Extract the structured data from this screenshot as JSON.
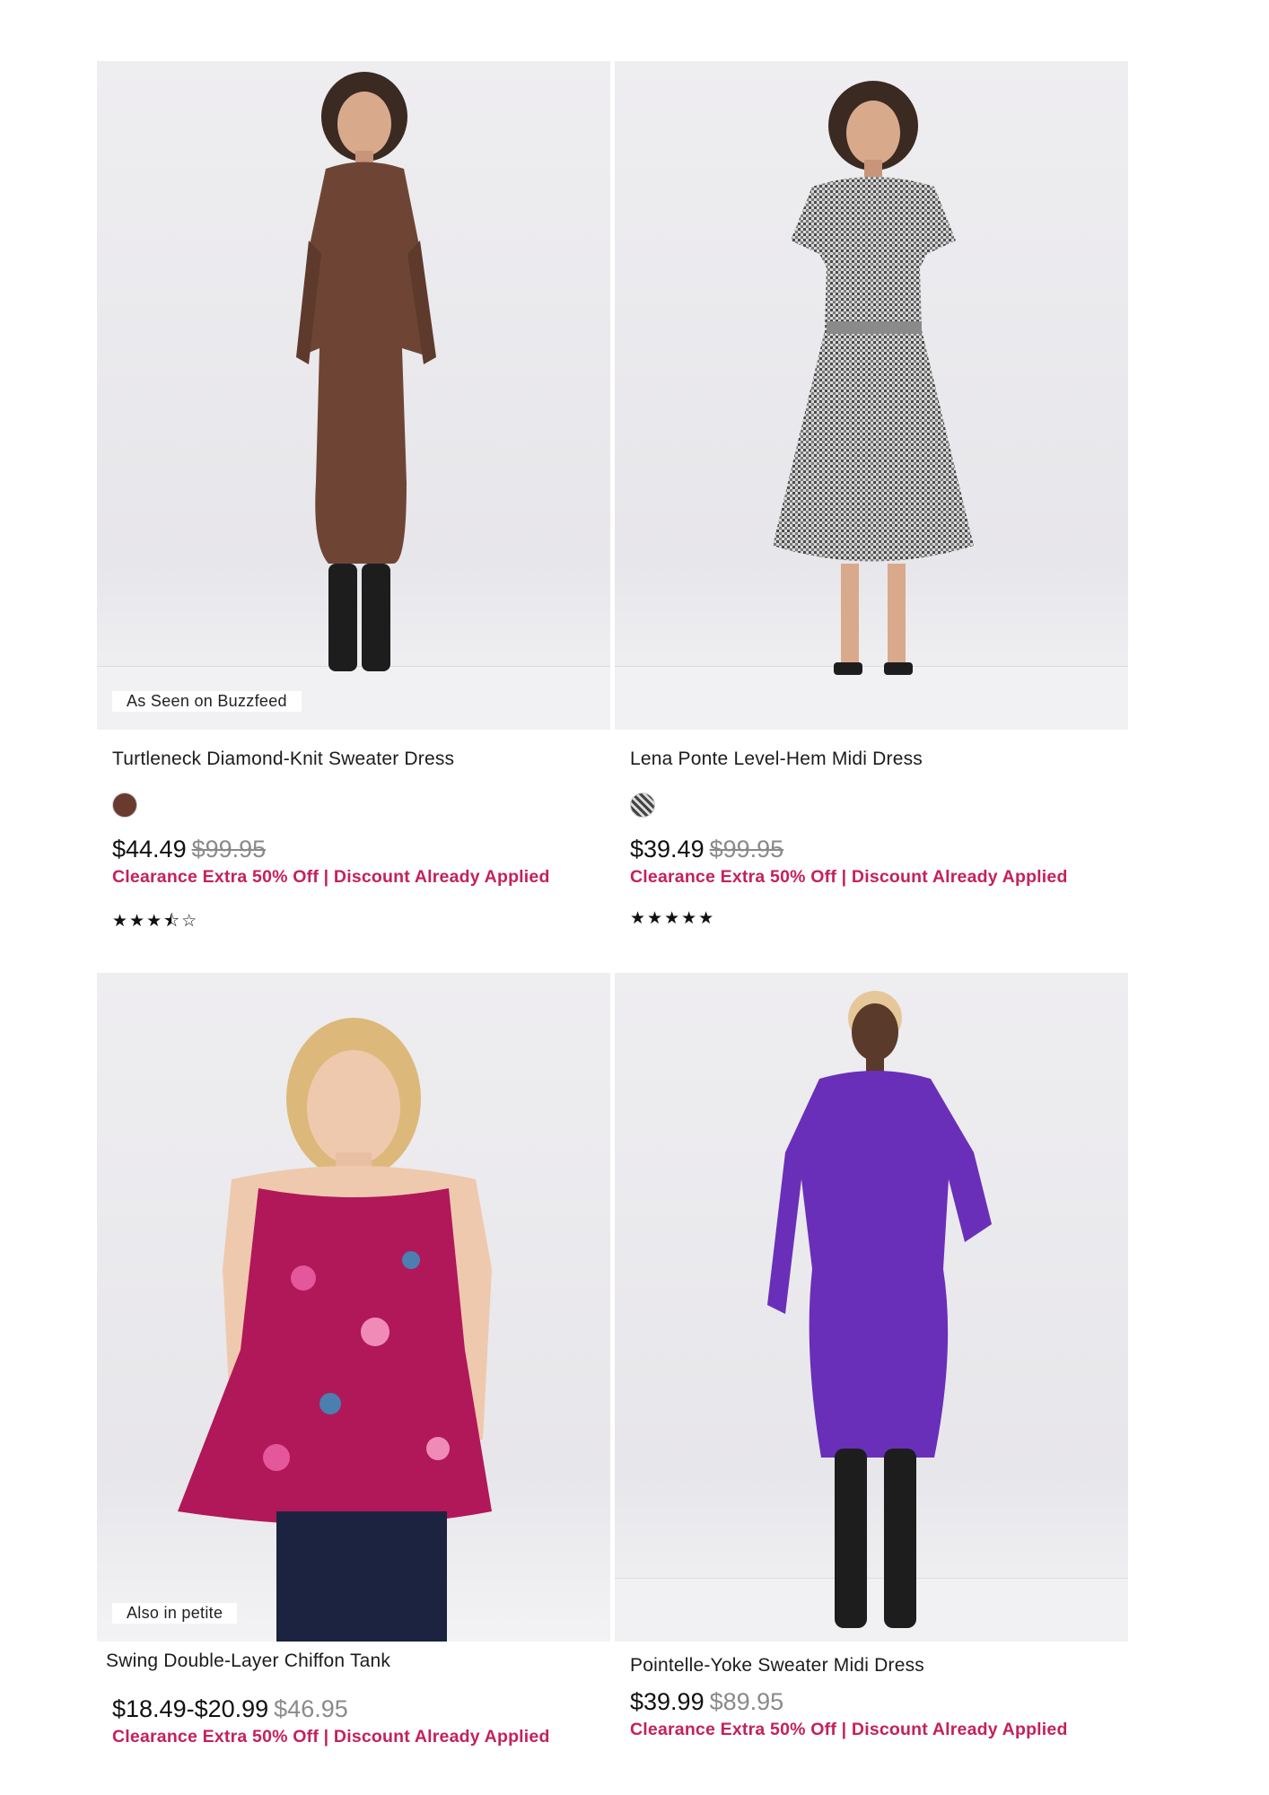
{
  "products": [
    {
      "name": "Turtleneck Diamond-Knit Sweater Dress",
      "badge": "As Seen on Buzzfeed",
      "swatch_color": "#6b3a2e",
      "price": "$44.49",
      "original_price": "$99.95",
      "promo": "Clearance Extra 50% Off | Discount Already Applied",
      "rating": 3.5,
      "rating_display": "★★★⯪☆"
    },
    {
      "name": "Lena Ponte Level-Hem Midi Dress",
      "swatch_pattern": "houndstooth",
      "price": "$39.49",
      "original_price": "$99.95",
      "promo": "Clearance Extra 50% Off | Discount Already Applied",
      "rating": 5,
      "rating_display": "★★★★★"
    },
    {
      "name": "Swing Double-Layer Chiffon Tank",
      "badge": "Also in petite",
      "price": "$18.49-$20.99",
      "original_price": "$46.95",
      "promo": "Clearance Extra 50% Off | Discount Already Applied"
    },
    {
      "name": "Pointelle-Yoke Sweater Midi Dress",
      "price": "$39.99",
      "original_price": "$89.95",
      "promo": "Clearance Extra 50% Off | Discount Already Applied"
    }
  ]
}
